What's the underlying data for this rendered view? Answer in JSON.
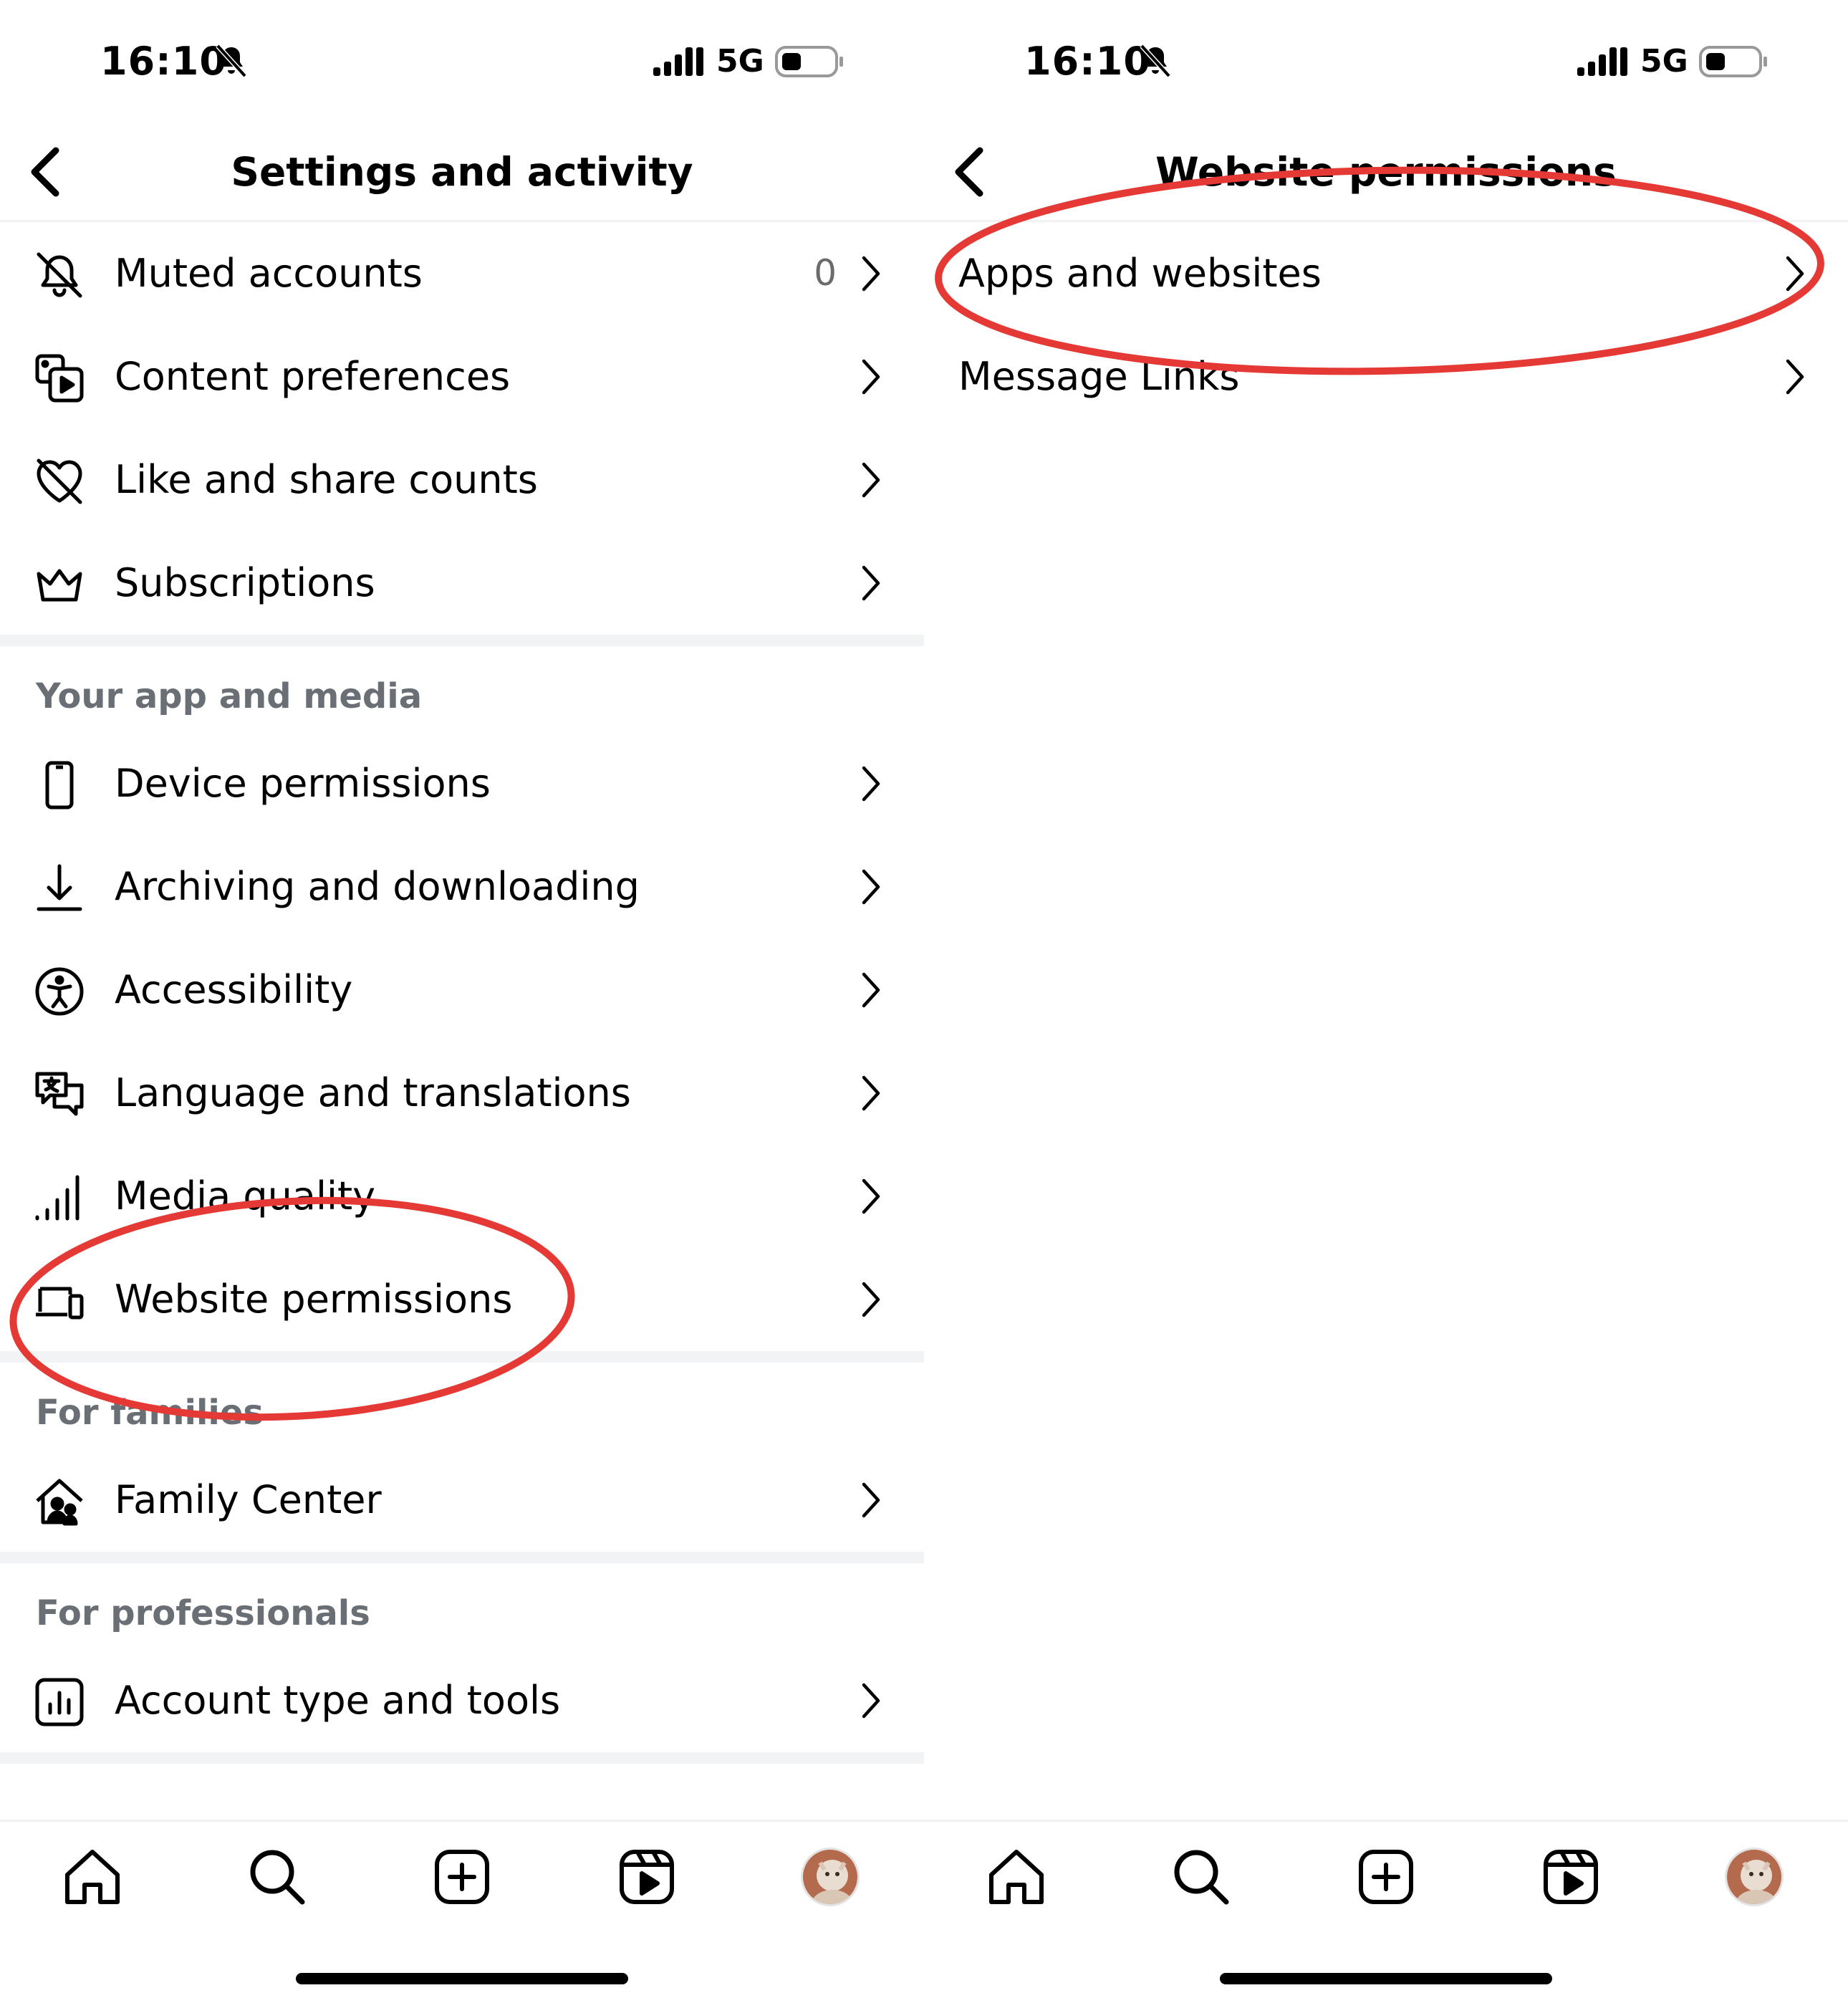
{
  "colors": {
    "annotation": "#e53935",
    "section_text": "#6a6e75",
    "divider": "#f2f3f5",
    "count_text": "#6b6b6b"
  },
  "left_screen": {
    "status": {
      "time": "16:10",
      "network": "5G"
    },
    "header": {
      "title": "Settings and activity"
    },
    "top_rows": [
      {
        "label": "Muted accounts",
        "count": "0",
        "icon": "muted-bell-icon"
      },
      {
        "label": "Content preferences",
        "icon": "media-play-icon"
      },
      {
        "label": "Like and share counts",
        "icon": "heart-slash-icon"
      },
      {
        "label": "Subscriptions",
        "icon": "crown-icon"
      }
    ],
    "section_app_media": {
      "title": "Your app and media",
      "rows": [
        {
          "label": "Device permissions",
          "icon": "phone-icon"
        },
        {
          "label": "Archiving and downloading",
          "icon": "download-icon"
        },
        {
          "label": "Accessibility",
          "icon": "accessibility-icon"
        },
        {
          "label": "Language and translations",
          "icon": "translate-icon"
        },
        {
          "label": "Media quality",
          "icon": "signal-bars-icon"
        },
        {
          "label": "Website permissions",
          "icon": "devices-icon"
        }
      ]
    },
    "section_families": {
      "title": "For families",
      "rows": [
        {
          "label": "Family Center",
          "icon": "family-home-icon"
        }
      ]
    },
    "section_professionals": {
      "title": "For professionals",
      "rows": [
        {
          "label": "Account type and tools",
          "icon": "chart-icon"
        }
      ]
    }
  },
  "right_screen": {
    "status": {
      "time": "16:10",
      "network": "5G"
    },
    "header": {
      "title": "Website permissions"
    },
    "rows": [
      {
        "label": "Apps and websites"
      },
      {
        "label": "Message Links"
      }
    ]
  },
  "bottom_nav": [
    "home-icon",
    "search-icon",
    "create-icon",
    "reels-icon",
    "profile-avatar"
  ]
}
